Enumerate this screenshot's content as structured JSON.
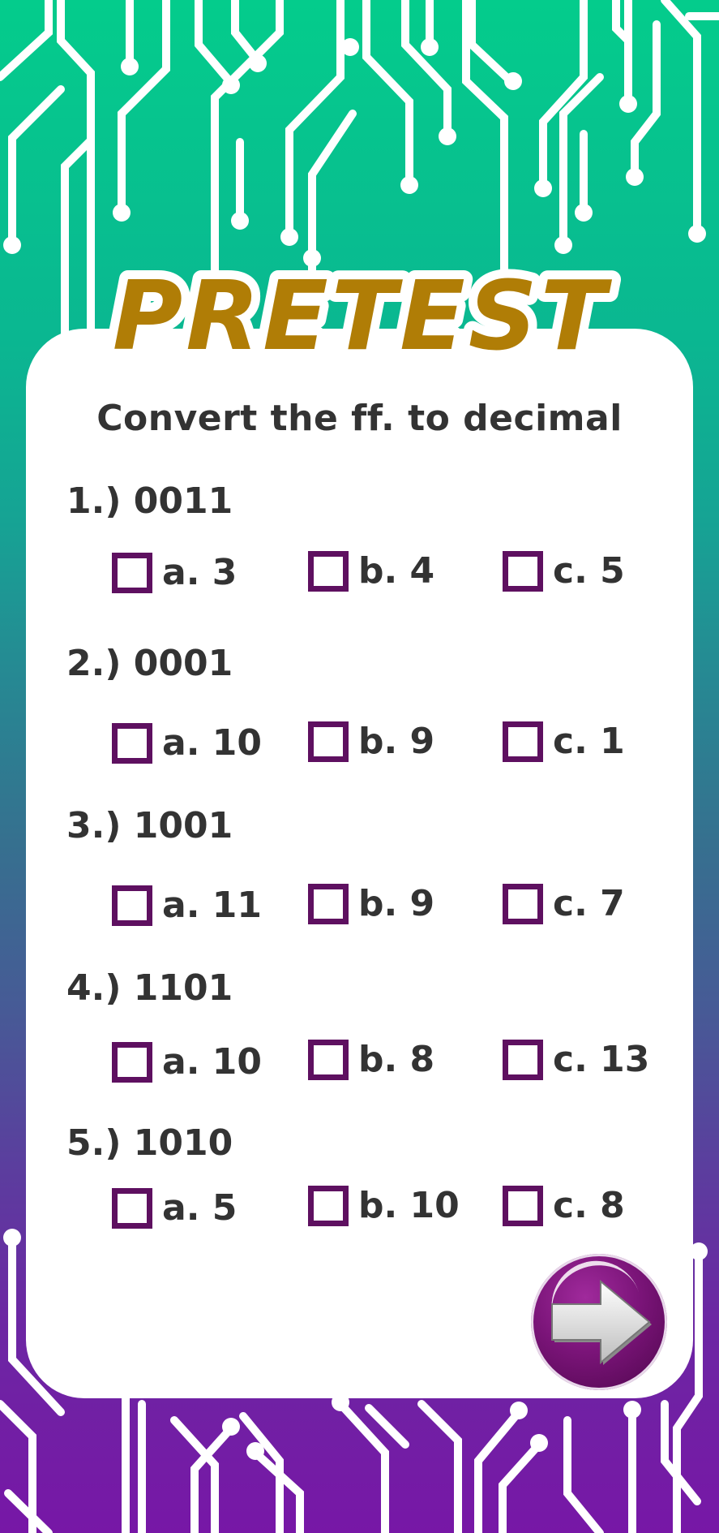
{
  "header": {
    "title": "PRETEST"
  },
  "instruction": "Convert the ff. to decimal",
  "questions": [
    {
      "label": "1.) 0011",
      "options": {
        "a": "a. 3",
        "b": "b. 4",
        "c": "c. 5"
      }
    },
    {
      "label": "2.) 0001",
      "options": {
        "a": "a. 10",
        "b": "b. 9",
        "c": "c. 1"
      }
    },
    {
      "label": "3.) 1001",
      "options": {
        "a": "a. 11",
        "b": "b. 9",
        "c": "c. 7"
      }
    },
    {
      "label": "4.) 1101",
      "options": {
        "a": "a. 10",
        "b": "b. 8",
        "c": "c. 13"
      }
    },
    {
      "label": "5.) 1010",
      "options": {
        "a": "a. 5",
        "b": "b. 10",
        "c": "c. 8"
      }
    }
  ],
  "colors": {
    "title_fill": "#b07d06",
    "checkbox_border": "#5e1060",
    "text": "#333333",
    "next_button": "#7a1478"
  },
  "next_button": {
    "icon": "arrow-right-icon"
  }
}
